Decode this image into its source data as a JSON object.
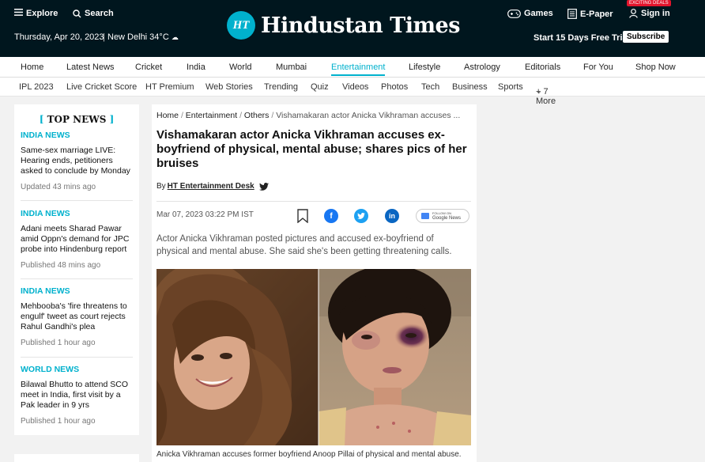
{
  "header": {
    "explore": "Explore",
    "search": "Search",
    "date": "Thursday, Apr 20, 2023",
    "city": "New Delhi 34°C",
    "logo_mark": "HT",
    "logo_text": "Hindustan Times",
    "games": "Games",
    "epaper": "E-Paper",
    "signin": "Sign in",
    "deals_badge": "EXCITING DEALS",
    "trial": "Start 15 Days Free Trial",
    "subscribe": "Subscribe"
  },
  "nav_primary": [
    "Home",
    "Latest News",
    "Cricket",
    "India",
    "World",
    "Mumbai",
    "Entertainment",
    "Lifestyle",
    "Astrology",
    "Editorials",
    "For You",
    "Shop Now"
  ],
  "nav_secondary": [
    "IPL 2023",
    "Live Cricket Score",
    "HT Premium",
    "Web Stories",
    "Trending",
    "Quiz",
    "Videos",
    "Photos",
    "Tech",
    "Business",
    "Sports",
    "+ 7 More"
  ],
  "sidebar": {
    "heading": "TOP NEWS",
    "items": [
      {
        "category": "INDIA NEWS",
        "title": "Same-sex marriage LIVE: Hearing ends, petitioners asked to conclude by Monday",
        "time": "Updated 43 mins ago"
      },
      {
        "category": "INDIA NEWS",
        "title": "Adani meets Sharad Pawar amid Oppn's demand for JPC probe into Hindenburg report",
        "time": "Published 48 mins ago"
      },
      {
        "category": "INDIA NEWS",
        "title": "Mehbooba's 'fire threatens to engulf' tweet as court rejects Rahul Gandhi's plea",
        "time": "Published 1 hour ago"
      },
      {
        "category": "WORLD NEWS",
        "title": "Bilawal Bhutto to attend SCO meet in India, first visit by a Pak leader in 9 yrs",
        "time": "Published 1 hour ago"
      }
    ]
  },
  "article": {
    "breadcrumb": [
      "Home",
      "Entertainment",
      "Others",
      "Vishamakaran actor Anicka Vikhraman accuses ..."
    ],
    "headline": "Vishamakaran actor Anicka Vikhraman accuses ex-boyfriend of physical, mental abuse; shares pics of her bruises",
    "by": "By",
    "author": "HT Entertainment Desk",
    "date": "Mar 07, 2023 03:22 PM IST",
    "gnews_small": "FOLLOW ON",
    "gnews": "Google News",
    "summary": "Actor Anicka Vikhraman posted pictures and accused ex-boyfriend of physical and mental abuse. She said she's been getting threatening calls.",
    "caption": "Anicka Vikhraman accuses former boyfriend Anoop Pillai of physical and mental abuse."
  }
}
